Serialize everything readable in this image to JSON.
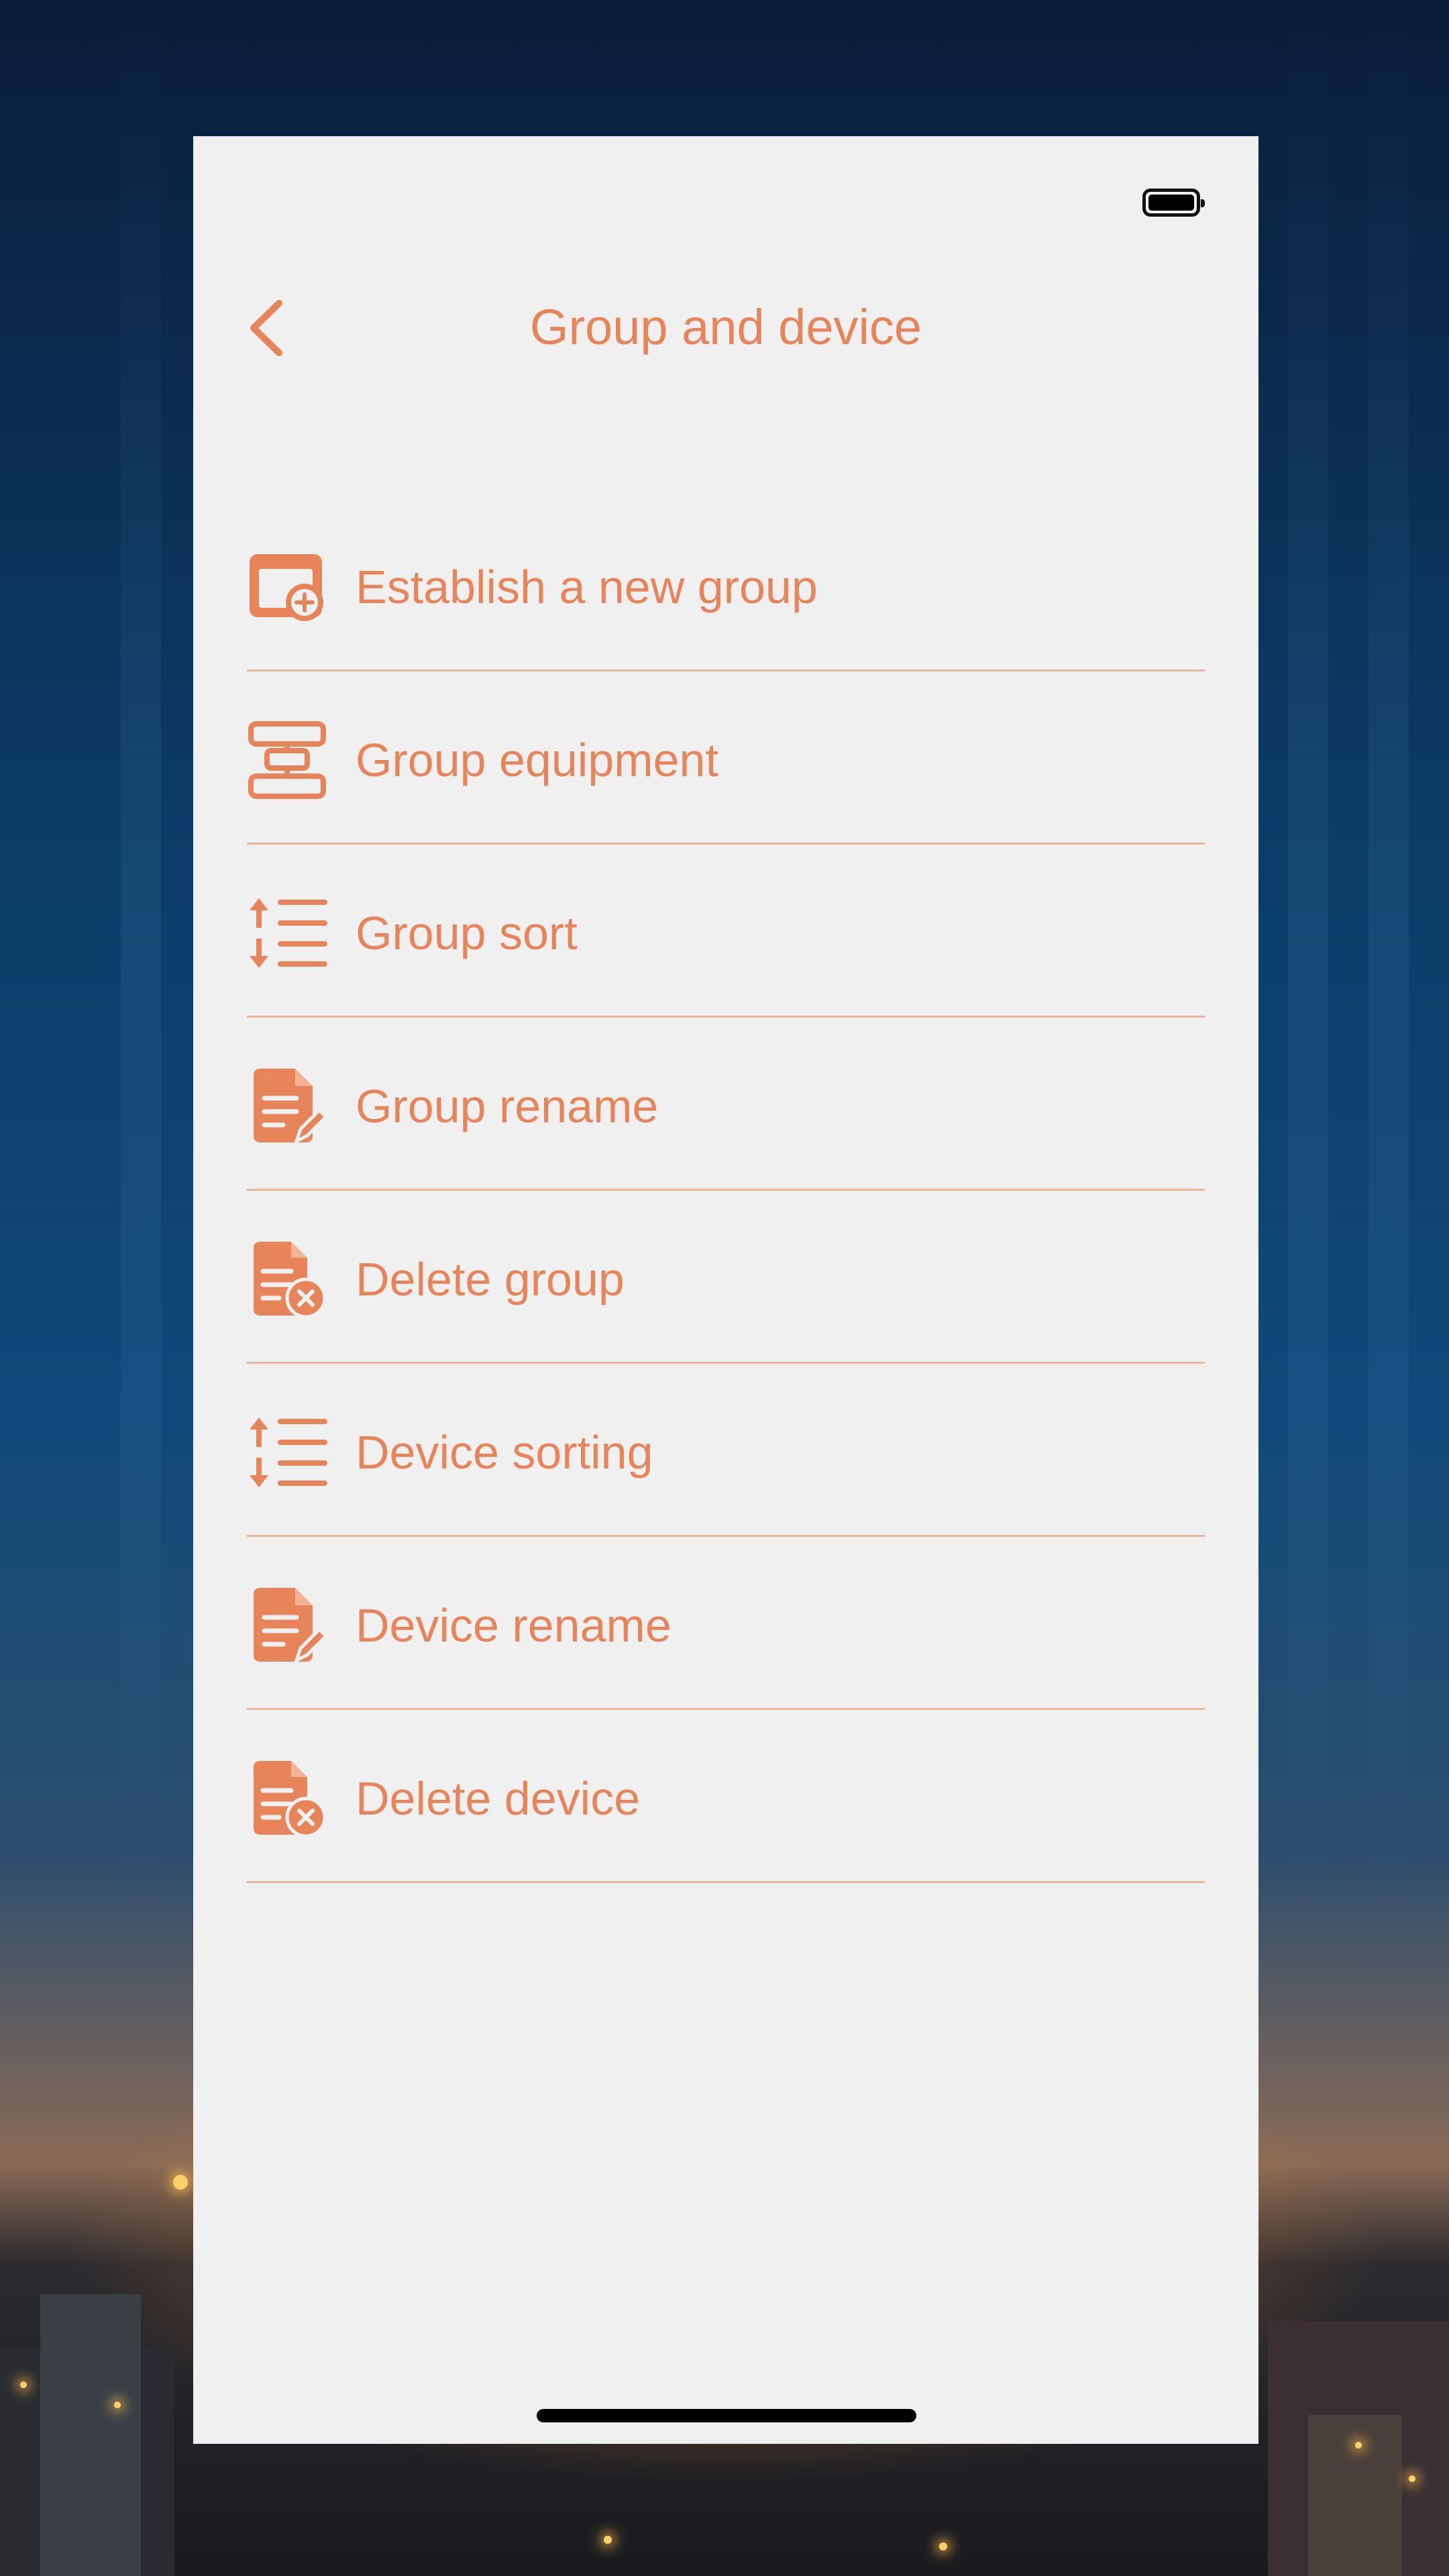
{
  "header": {
    "title": "Group and device",
    "back_icon": "chevron-left-icon"
  },
  "status_bar": {
    "battery_icon": "battery-full-icon"
  },
  "menu": {
    "items": [
      {
        "label": "Establish a new group",
        "icon": "folder-plus-icon"
      },
      {
        "label": "Group equipment",
        "icon": "hierarchy-icon"
      },
      {
        "label": "Group sort",
        "icon": "sort-list-icon"
      },
      {
        "label": "Group rename",
        "icon": "document-edit-icon"
      },
      {
        "label": "Delete group",
        "icon": "document-delete-icon"
      },
      {
        "label": "Device sorting",
        "icon": "sort-list-icon"
      },
      {
        "label": "Device rename",
        "icon": "document-edit-icon"
      },
      {
        "label": "Delete device",
        "icon": "document-delete-icon"
      }
    ]
  },
  "colors": {
    "accent": "#e8845a",
    "divider": "#e9b59d",
    "panel_background": "#f0f0f0"
  }
}
